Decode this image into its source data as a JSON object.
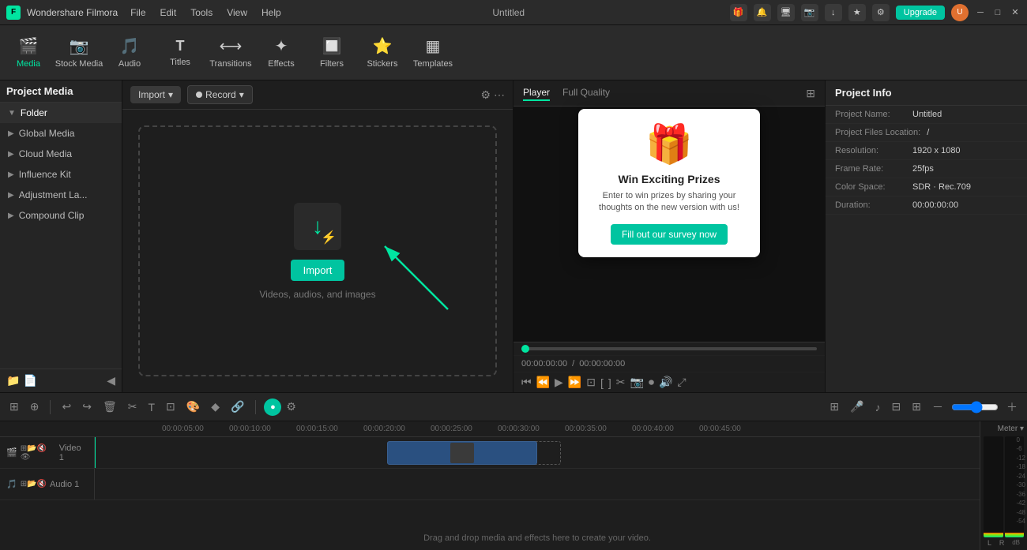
{
  "app": {
    "name": "Wondershare Filmora",
    "title": "Untitled"
  },
  "titlebar": {
    "menu": [
      "File",
      "Edit",
      "Tools",
      "View",
      "Help"
    ],
    "upgrade_label": "Upgrade",
    "icons": [
      "gift",
      "bell",
      "monitor",
      "camera",
      "download",
      "star",
      "settings"
    ]
  },
  "toolbar": {
    "items": [
      {
        "id": "media",
        "label": "Media",
        "icon": "🎬",
        "active": true
      },
      {
        "id": "stock",
        "label": "Stock Media",
        "icon": "📷"
      },
      {
        "id": "audio",
        "label": "Audio",
        "icon": "🎵"
      },
      {
        "id": "titles",
        "label": "Titles",
        "icon": "T"
      },
      {
        "id": "transitions",
        "label": "Transitions",
        "icon": "⟷"
      },
      {
        "id": "effects",
        "label": "Effects",
        "icon": "✦"
      },
      {
        "id": "filters",
        "label": "Filters",
        "icon": "🔲"
      },
      {
        "id": "stickers",
        "label": "Stickers",
        "icon": "⭐"
      },
      {
        "id": "templates",
        "label": "Templates",
        "icon": "▦"
      }
    ]
  },
  "sidebar": {
    "title": "Project Media",
    "items": [
      {
        "id": "folder",
        "label": "Folder",
        "indent": true
      },
      {
        "id": "global",
        "label": "Global Media",
        "arrow": "▶"
      },
      {
        "id": "cloud",
        "label": "Cloud Media",
        "arrow": "▶"
      },
      {
        "id": "influence",
        "label": "Influence Kit",
        "arrow": "▶"
      },
      {
        "id": "adjustment",
        "label": "Adjustment La...",
        "arrow": "▶"
      },
      {
        "id": "compound",
        "label": "Compound Clip",
        "arrow": "▶"
      }
    ]
  },
  "media_panel": {
    "import_label": "Import",
    "record_label": "Record",
    "drop_hint": "Videos, audios, and images",
    "import_btn_label": "Import"
  },
  "player": {
    "tabs": [
      "Player",
      "Full Quality"
    ],
    "active_tab": "Player",
    "time_current": "00:00:00:00",
    "time_total": "00:00:00:00"
  },
  "survey": {
    "title": "Win Exciting Prizes",
    "desc": "Enter to win prizes by sharing your thoughts on the new version with us!",
    "btn_label": "Fill out our survey now"
  },
  "project_info": {
    "title": "Project Info",
    "fields": [
      {
        "label": "Project Name:",
        "value": "Untitled"
      },
      {
        "label": "Project Files Location:",
        "value": "/"
      },
      {
        "label": "Resolution:",
        "value": "1920 x 1080"
      },
      {
        "label": "Frame Rate:",
        "value": "25fps"
      },
      {
        "label": "Color Space:",
        "value": "SDR · Rec.709"
      },
      {
        "label": "Duration:",
        "value": "00:00:00:00"
      }
    ]
  },
  "timeline": {
    "ruler_marks": [
      "00:00:05:00",
      "00:00:10:00",
      "00:00:15:00",
      "00:00:20:00",
      "00:00:25:00",
      "00:00:30:00",
      "00:00:35:00",
      "00:00:40:00",
      "00:00:45:00"
    ],
    "tracks": [
      {
        "id": "video1",
        "label": "Video 1",
        "type": "video"
      },
      {
        "id": "audio1",
        "label": "Audio 1",
        "type": "audio"
      }
    ],
    "drop_hint": "Drag and drop media and effects here to create your video.",
    "meter_label": "Meter ▾",
    "meter_scale": [
      "0",
      "-6",
      "-12",
      "-18",
      "-24",
      "-30",
      "-36",
      "-42",
      "-48",
      "-54"
    ],
    "meter_lr": [
      "L",
      "R"
    ]
  }
}
